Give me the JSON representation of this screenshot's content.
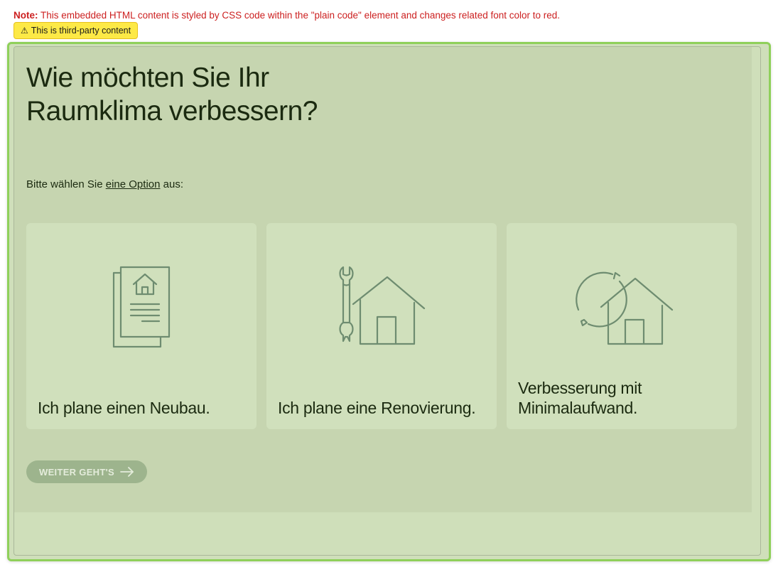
{
  "note": {
    "label": "Note:",
    "text": "This embedded HTML content is styled by CSS code within the \"plain code\" element and changes related font color to red."
  },
  "badge": {
    "icon": "warning-icon",
    "text": "This is third-party content"
  },
  "main": {
    "headline": "Wie möchten Sie Ihr Raumklima verbessern?",
    "instruction": {
      "prefix": "Bitte wählen Sie ",
      "underlined": "eine Option",
      "suffix": " aus:"
    },
    "cards": [
      {
        "icon": "document-house-icon",
        "label": "Ich plane einen Neubau."
      },
      {
        "icon": "wrench-house-icon",
        "label": "Ich plane eine Renovierung."
      },
      {
        "icon": "refresh-house-icon",
        "label": "Verbesserung mit Minimalaufwand."
      }
    ],
    "next_button": {
      "label": "WEITER GEHT'S",
      "icon": "arrow-right-icon"
    }
  },
  "colors": {
    "note_red": "#cc1f1f",
    "badge_yellow": "#fde946",
    "frame_green": "#8fd05a",
    "content_bg": "#c6d5b0",
    "card_bg": "#d0e0bc",
    "icon_stroke": "#6e8c70",
    "button_bg": "#9db48d",
    "text_dark": "#1b2a10"
  }
}
